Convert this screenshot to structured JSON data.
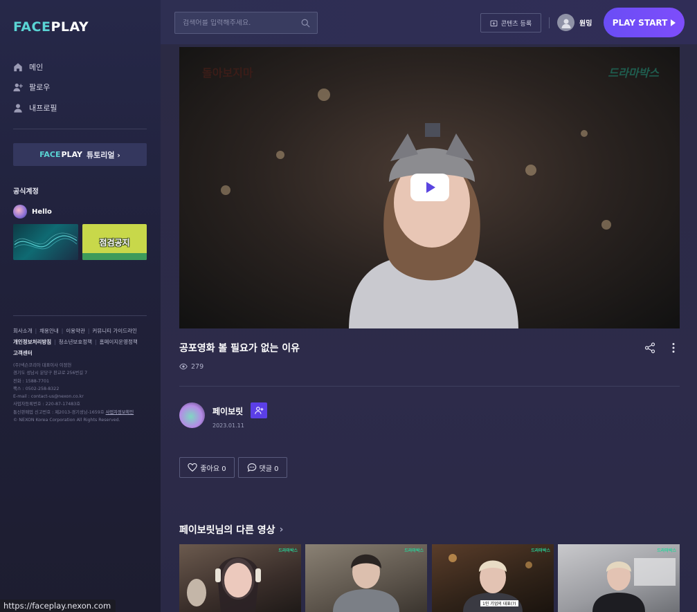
{
  "logo": {
    "part1": "FACE",
    "part2": "PLAY"
  },
  "nav": [
    {
      "label": "메인",
      "icon": "home-icon"
    },
    {
      "label": "팔로우",
      "icon": "user-plus-icon"
    },
    {
      "label": "내프로필",
      "icon": "user-icon"
    }
  ],
  "tutorial": {
    "logo1": "FACE",
    "logo2": "PLAY",
    "label": "튜토리얼 ›"
  },
  "official": {
    "title": "공식계정",
    "account": "Hello",
    "banner2_text": "점검공지"
  },
  "footer": {
    "links_row1": [
      "회사소개",
      "채용안내",
      "이용약관",
      "커뮤니티 가이드라인"
    ],
    "links_row2_bold": "개인정보처리방침",
    "links_row2": [
      "청소년보호정책",
      "홈페이지운영정책"
    ],
    "links_row3": "고객센터",
    "info": [
      "(주)넥슨코리아 대표이사 이정헌",
      "경기도 성남시 분당구 판교로 256번길 7",
      "전화 : 1588-7701",
      "팩스 : 0502-258-8322",
      "E-mail : contact-us@nexon.co.kr",
      "사업자등록번호 : 220-87-17483호",
      "통신판매업 신고번호 : 제2013-경기성남-1659호",
      "사업자정보확인",
      "© NEXON Korea Corporation All Rights Reserved."
    ]
  },
  "header": {
    "search_placeholder": "검색어를 입력해주세요.",
    "upload_label": "콘텐츠 등록",
    "username": "원밍",
    "play_start": "PLAY START"
  },
  "video": {
    "watermark_left": "돌아보지마",
    "watermark_right": "드라마박스",
    "title": "공포영화 볼 필요가 없는 이유",
    "views": "279"
  },
  "creator": {
    "name": "페이보릿",
    "date": "2023.01.11"
  },
  "actions": {
    "like": "좋아요 0",
    "comment": "댓글 0"
  },
  "other": {
    "title": "페이보릿님의 다른 영상",
    "thumb_tag": "드라마박스",
    "thumb_caption": "1인 기업의 대표(?)"
  },
  "statusbar": "https://faceplay.nexon.com",
  "colors": {
    "accent": "#6a4df5",
    "teal": "#5ad4d4",
    "follow": "#5b3fe6"
  }
}
